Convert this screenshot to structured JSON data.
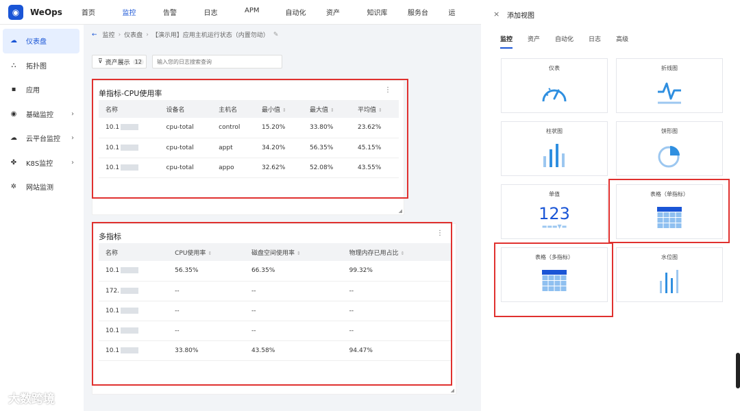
{
  "app": {
    "name": "WeOps",
    "logo_glyph": "◉"
  },
  "nav": [
    "首页",
    "监控",
    "告警",
    "日志",
    "APM",
    "自动化",
    "资产",
    "知识库",
    "服务台",
    "运"
  ],
  "nav_active_index": 1,
  "sidebar": [
    {
      "label": "仪表盘",
      "icon": "dashboard-icon",
      "glyph": "☁",
      "active": true,
      "arrow": ""
    },
    {
      "label": "拓扑图",
      "icon": "topology-icon",
      "glyph": "⛬",
      "active": false,
      "arrow": ""
    },
    {
      "label": "应用",
      "icon": "app-icon",
      "glyph": "▪",
      "active": false,
      "arrow": ""
    },
    {
      "label": "基础监控",
      "icon": "basic-monitor-icon",
      "glyph": "◉",
      "active": false,
      "arrow": "›"
    },
    {
      "label": "云平台监控",
      "icon": "cloud-icon",
      "glyph": "☁",
      "active": false,
      "arrow": "›"
    },
    {
      "label": "K8S监控",
      "icon": "k8s-icon",
      "glyph": "✤",
      "active": false,
      "arrow": "›"
    },
    {
      "label": "网站监测",
      "icon": "website-icon",
      "glyph": "✲",
      "active": false,
      "arrow": ""
    }
  ],
  "breadcrumb": {
    "back": "←",
    "items": [
      "监控",
      "仪表盘",
      "【演示用】应用主机运行状态（内置勿动）"
    ],
    "sep": "›",
    "edit": "✎"
  },
  "filter": {
    "label": "资产展示",
    "count": "12",
    "glyph": "⊽"
  },
  "search": {
    "placeholder": "输入您的日志搜索查询"
  },
  "widget1": {
    "title": "单指标-CPU使用率",
    "more": "⋮",
    "columns": [
      "名称",
      "设备名",
      "主机名",
      "最小值",
      "最大值",
      "平均值"
    ],
    "rows": [
      [
        "10.1",
        "cpu-total",
        "control",
        "15.20%",
        "33.80%",
        "23.62%"
      ],
      [
        "10.1",
        "cpu-total",
        "appt",
        "34.20%",
        "56.35%",
        "45.15%"
      ],
      [
        "10.1",
        "cpu-total",
        "appo",
        "32.62%",
        "52.08%",
        "43.55%"
      ]
    ]
  },
  "widget2": {
    "title": "多指标",
    "more": "⋮",
    "columns": [
      "名称",
      "CPU使用率",
      "磁盘空间使用率",
      "物理内存已用占比"
    ],
    "rows": [
      [
        "10.1",
        "56.35%",
        "66.35%",
        "99.32%"
      ],
      [
        "172.",
        "--",
        "--",
        "--"
      ],
      [
        "10.1",
        "--",
        "--",
        "--"
      ],
      [
        "10.1",
        "--",
        "--",
        "--"
      ],
      [
        "10.1",
        "33.80%",
        "43.58%",
        "94.47%"
      ]
    ]
  },
  "panel": {
    "close": "×",
    "title": "添加视图",
    "tabs": [
      "监控",
      "资产",
      "自动化",
      "日志",
      "高级"
    ],
    "tiles": [
      {
        "label": "仪表",
        "icon": "gauge-icon"
      },
      {
        "label": "折线图",
        "icon": "line-chart-icon"
      },
      {
        "label": "柱状图",
        "icon": "bar-chart-icon"
      },
      {
        "label": "饼形图",
        "icon": "pie-chart-icon"
      },
      {
        "label": "单值",
        "icon": "single-value-icon",
        "value_text": "123"
      },
      {
        "label": "表格（单指标）",
        "icon": "table-icon"
      },
      {
        "label": "表格（多指标）",
        "icon": "table-icon"
      },
      {
        "label": "水位图",
        "icon": "waterlevel-icon"
      }
    ]
  },
  "watermark": "大数跨境",
  "colors": {
    "accent": "#1a55d6",
    "highlight": "#e0302e",
    "icon": "#2f8fe0"
  }
}
